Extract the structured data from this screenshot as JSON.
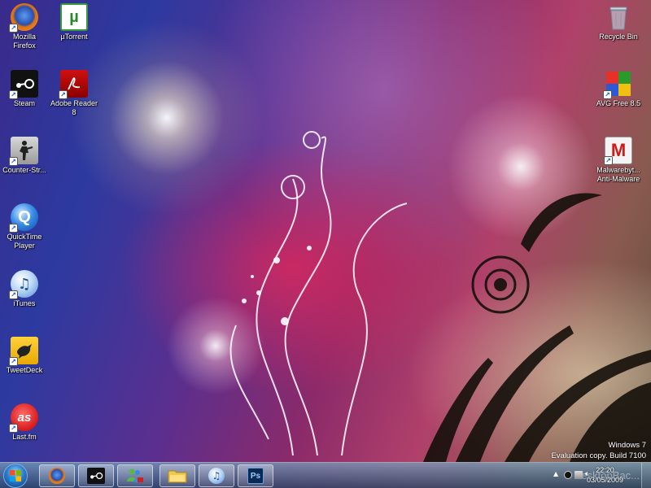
{
  "desktop": {
    "icons_left": [
      {
        "label": "Mozilla\nFirefox",
        "icon": "firefox-icon"
      },
      {
        "label": "µTorrent",
        "icon": "utorrent-icon"
      },
      {
        "label": "Steam",
        "icon": "steam-icon"
      },
      {
        "label": "Adobe Reader\n8",
        "icon": "adobe-reader-icon"
      },
      {
        "label": "Counter-Str...",
        "icon": "counter-strike-icon"
      },
      {
        "label": "QuickTime\nPlayer",
        "icon": "quicktime-icon"
      },
      {
        "label": "iTunes",
        "icon": "itunes-icon"
      },
      {
        "label": "TweetDeck",
        "icon": "tweetdeck-icon"
      },
      {
        "label": "Last.fm",
        "icon": "lastfm-icon"
      }
    ],
    "icons_right": [
      {
        "label": "Recycle Bin",
        "icon": "recycle-bin-icon"
      },
      {
        "label": "AVG Free 8.5",
        "icon": "avg-icon"
      },
      {
        "label": "Malwarebyt...\nAnti-Malware",
        "icon": "malwarebytes-icon"
      }
    ],
    "watermark": {
      "line1": "Windows 7",
      "line2": "Evaluation copy. Build 7100"
    }
  },
  "taskbar": {
    "pinned": [
      "firefox-icon",
      "steam-icon",
      "windows-live-messenger-icon",
      "windows-explorer-icon",
      "itunes-icon",
      "photoshop-icon"
    ],
    "photoshop_label": "Ps",
    "clock_time": "22:20",
    "clock_date": "03/05/2009",
    "site_watermark": "DesktopBac..."
  },
  "colors": {
    "taskbar": "#3c6a8c",
    "accent": "#e0306a"
  }
}
